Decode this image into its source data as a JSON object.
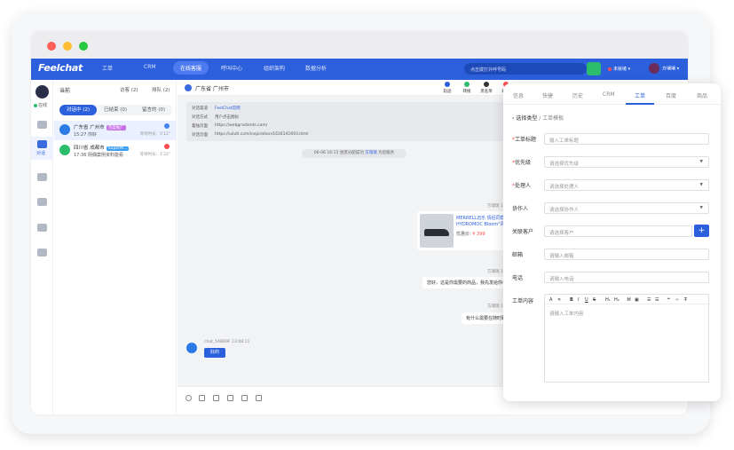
{
  "colors": {
    "brand": "#2c5fdc",
    "call": "#2bbd6c",
    "offline": "#ff4d4f",
    "mac_red": "#fe5f57",
    "mac_yellow": "#febc2e",
    "mac_green": "#28c840"
  },
  "topnav": {
    "logo": "Feelchat",
    "items": [
      "工单",
      "CRM",
      "在线客服",
      "呼叫中心",
      "组织架构",
      "数据分析"
    ],
    "active": "在线客服",
    "search_placeholder": "点击拨打外呼号码",
    "status": "未就绪",
    "user_name": "方瑞瑞"
  },
  "sidebar": {
    "online": "在线",
    "active_label": "对话",
    "icons": [
      "home-icon",
      "chat-icon",
      "eye-icon",
      "clock-icon",
      "contact-card-icon",
      "chart-icon"
    ]
  },
  "convlist": {
    "title": "当前",
    "visit": "访客 (2)",
    "queue": "排队 (2)",
    "tabs": [
      "对话中 (2)",
      "已结束 (0)",
      "留言的 (0)"
    ],
    "items": [
      {
        "loc": "广东省 广州市",
        "tag": "百度推广",
        "time": "15:27",
        "last": "你好",
        "wait": "等待时长：0'12\""
      },
      {
        "loc": "四川省 成都市",
        "tag": "SuperM...",
        "time": "17:36",
        "last": "阴偶案例资料能看",
        "wait": "等待时长：1'22\""
      }
    ]
  },
  "chat": {
    "title": "广东省 广州市",
    "tools": [
      "轨迹",
      "转接",
      "黑名单",
      "结束"
    ],
    "info": [
      {
        "k": "对话渠道",
        "v": "FeelChat官网"
      },
      {
        "k": "对话方式",
        "v": "用户点击图标"
      },
      {
        "k": "着陆页面",
        "v": "https://webgradients.com/"
      },
      {
        "k": "对话页面",
        "v": "https://uilutl.com/inspiration/1616141693.html"
      }
    ],
    "system": {
      "pre": "06-06 16:15 坐席分配成功",
      "agent": "方瑞瑞",
      "post": "为您服务"
    },
    "agent_name": "方瑞瑞",
    "product": {
      "time": "13:06:29",
      "title": "MERRELL迈乐 情侣同款 雨鞋HYDROMOC Bloom\"青...",
      "price_label": "优惠价:",
      "price": "¥ 399"
    },
    "m1": {
      "time": "13:57:53",
      "text": "您好，这是你需要的商品，我先发给你看一下"
    },
    "m2": {
      "time": "13:58:02",
      "text": "有什么需要在随时联系我~"
    },
    "visitor": {
      "name": "chat_5ABB9F",
      "time": "13:08:11",
      "text": "好的"
    }
  },
  "panel": {
    "tabs": [
      "信息",
      "快捷",
      "历史",
      "CRM",
      "工单",
      "百度",
      "商品"
    ],
    "active": "工单",
    "crumb": "选择类型",
    "crumb_sub": "/ 工单模板",
    "fields": [
      {
        "label": "工单标题",
        "req": true,
        "ph": "输入工单标题",
        "type": "text"
      },
      {
        "label": "优先级",
        "req": true,
        "ph": "请选择优先级",
        "type": "select"
      },
      {
        "label": "处理人",
        "req": true,
        "ph": "请选择处理人",
        "type": "select"
      },
      {
        "label": "协作人",
        "req": false,
        "ph": "请选择协作人",
        "type": "select"
      },
      {
        "label": "关联客户",
        "req": false,
        "ph": "请选择客户",
        "type": "add"
      },
      {
        "label": "邮箱",
        "req": false,
        "ph": "请输入邮箱",
        "type": "text"
      },
      {
        "label": "电话",
        "req": false,
        "ph": "请输入电话",
        "type": "text"
      }
    ],
    "content_label": "工单内容",
    "content_ph": "请输入工单内容"
  }
}
